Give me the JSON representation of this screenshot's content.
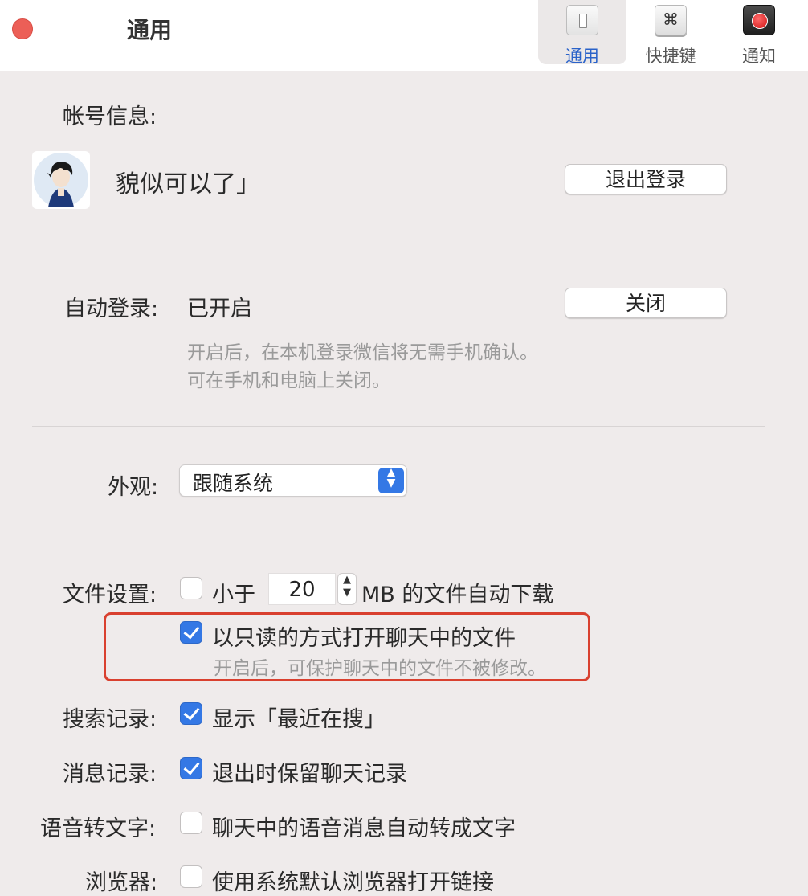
{
  "window": {
    "title": "通用"
  },
  "toolbar": {
    "tabs": [
      {
        "label": "通用",
        "icon": "switch-icon",
        "active": true
      },
      {
        "label": "快捷键",
        "icon": "command-key-icon",
        "glyph": "⌘",
        "active": false
      },
      {
        "label": "通知",
        "icon": "notification-icon",
        "active": false
      }
    ]
  },
  "account": {
    "section_label": "帐号信息:",
    "username": "貌似可以了」",
    "logout_button": "退出登录"
  },
  "auto_login": {
    "label": "自动登录:",
    "status": "已开启",
    "button": "关闭",
    "hint_line1": "开启后，在本机登录微信将无需手机确认。",
    "hint_line2": "可在手机和电脑上关闭。"
  },
  "appearance": {
    "label": "外观:",
    "selected": "跟随系统"
  },
  "file_settings": {
    "label": "文件设置:",
    "auto_download_prefix": "小于",
    "auto_download_size": "20",
    "auto_download_suffix": "MB 的文件自动下载",
    "auto_download_checked": false,
    "readonly_label": "以只读的方式打开聊天中的文件",
    "readonly_checked": true,
    "readonly_hint": "开启后，可保护聊天中的文件不被修改。"
  },
  "search_history": {
    "label": "搜索记录:",
    "option": "显示「最近在搜」",
    "checked": true
  },
  "message_history": {
    "label": "消息记录:",
    "option": "退出时保留聊天记录",
    "checked": true
  },
  "voice_to_text": {
    "label": "语音转文字:",
    "option": "聊天中的语音消息自动转成文字",
    "checked": false
  },
  "browser": {
    "label": "浏览器:",
    "option": "使用系统默认浏览器打开链接",
    "checked": false
  },
  "colors": {
    "accent": "#3478e5",
    "close_button": "#ec5f57",
    "highlight_box": "#d9402f"
  }
}
